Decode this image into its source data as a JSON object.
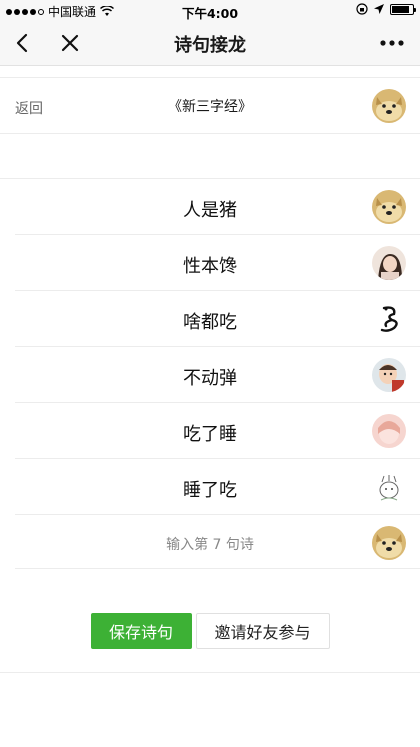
{
  "status_bar": {
    "carrier": "中国联通",
    "time": "下午4:00",
    "signal_bars": 5,
    "battery_percent": 0.85
  },
  "nav": {
    "title": "诗句接龙",
    "back_icon": "chevron-left-icon",
    "close_icon": "close-icon",
    "more_icon": "more-icon"
  },
  "header": {
    "back_label": "返回",
    "book_title": "《新三字经》"
  },
  "poems": [
    {
      "text": "人是猪",
      "avatar": "doge"
    },
    {
      "text": "性本馋",
      "avatar": "girl"
    },
    {
      "text": "啥都吃",
      "avatar": "dragon"
    },
    {
      "text": "不动弹",
      "avatar": "baby"
    },
    {
      "text": "吃了睡",
      "avatar": "pink"
    },
    {
      "text": "睡了吃",
      "avatar": "sketch"
    }
  ],
  "input": {
    "placeholder": "输入第 7 句诗"
  },
  "actions": {
    "save_label": "保存诗句",
    "invite_label": "邀请好友参与"
  },
  "colors": {
    "accent": "#3db135",
    "nav_bg": "#f7f7f7"
  }
}
